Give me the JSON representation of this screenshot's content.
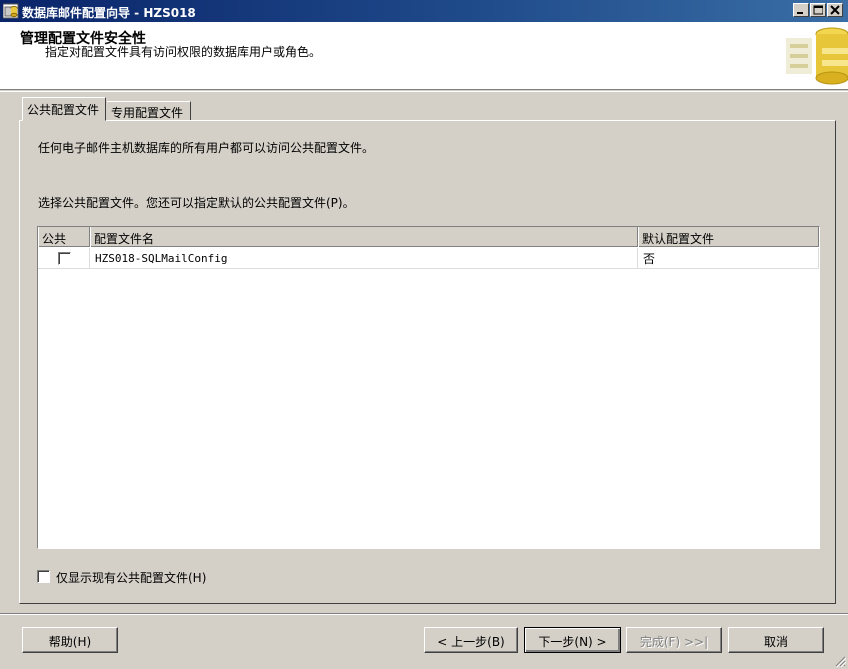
{
  "window": {
    "title": "数据库邮件配置向导 - HZS018",
    "minimize_icon": "minimize-icon",
    "maximize_icon": "maximize-icon",
    "close_icon": "close-icon"
  },
  "header": {
    "title": "管理配置文件安全性",
    "subtitle": "指定对配置文件具有访问权限的数据库用户或角色。"
  },
  "tabs": [
    {
      "label": "公共配置文件",
      "active": true
    },
    {
      "label": "专用配置文件",
      "active": false
    }
  ],
  "panel": {
    "info_text": "任何电子邮件主机数据库的所有用户都可以访问公共配置文件。",
    "instruction_text": "选择公共配置文件。您还可以指定默认的公共配置文件(P)。"
  },
  "grid": {
    "columns": [
      "公共",
      "配置文件名",
      "默认配置文件"
    ],
    "rows": [
      {
        "public": false,
        "profile_name": "HZS018-SQLMailConfig",
        "default": "否"
      }
    ]
  },
  "show_existing_only": {
    "label": "仅显示现有公共配置文件(H)",
    "checked": false
  },
  "buttons": {
    "help": "帮助(H)",
    "back": "< 上一步(B)",
    "next": "下一步(N) >",
    "finish": "完成(F) >>|",
    "cancel": "取消"
  },
  "colors": {
    "titlebar": "#0a246a",
    "face": "#d4d0c8"
  }
}
